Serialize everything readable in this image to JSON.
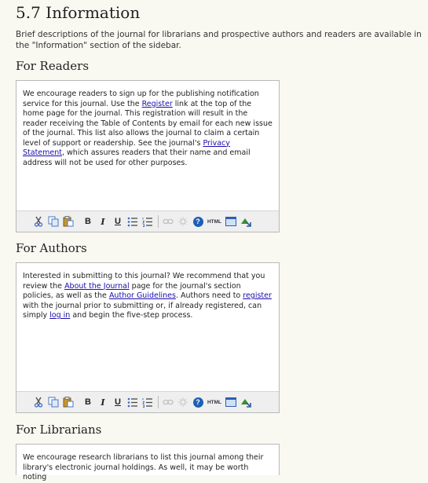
{
  "heading": "5.7 Information",
  "intro": "Brief descriptions of the journal for librarians and prospective authors and readers are available in the \"Information\" section of the sidebar.",
  "sections": {
    "readers": {
      "title": "For Readers",
      "t1": "We encourage readers to sign up for the publishing notification service for this journal. Use the ",
      "link1": "Register",
      "t2": " link at the top of the home page for the journal. This registration will result in the reader receiving the Table of Contents by email for each new issue of the journal. This list also allows the journal to claim a certain level of support or readership. See the journal's ",
      "link2": "Privacy Statement",
      "t3": ", which assures readers that their name and email address will not be used for other purposes."
    },
    "authors": {
      "title": "For Authors",
      "t1": "Interested in submitting to this journal? We recommend that you review the ",
      "link1": "About the Journal",
      "t2": " page for the journal's section policies, as well as the ",
      "link2": "Author Guidelines",
      "t3": ". Authors need to ",
      "link3": "register",
      "t4": " with the journal prior to submitting or, if already registered, can simply ",
      "link4": "log in",
      "t5": " and begin the five-step process."
    },
    "librarians": {
      "title": "For Librarians",
      "t1": "We encourage research librarians to list this journal among their library's electronic journal holdings. As well, it may be worth noting"
    }
  },
  "toolbar": {
    "bold": "B",
    "italic": "I",
    "underline": "U",
    "help": "?",
    "html": "HTML"
  }
}
